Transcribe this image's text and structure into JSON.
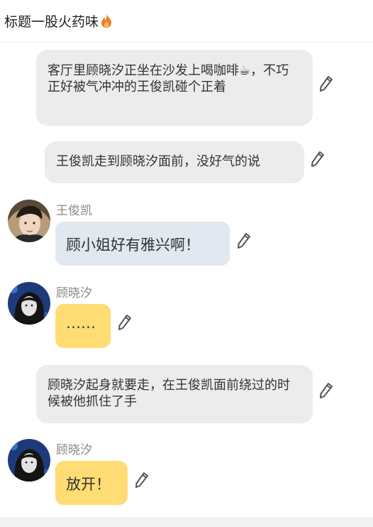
{
  "header": {
    "title": "标题一股火药味"
  },
  "messages": [
    {
      "type": "narration",
      "text": "客厅里顾晓汐正坐在沙发上喝咖啡☕，不巧正好被气冲冲的王俊凯碰个正着"
    },
    {
      "type": "narration",
      "text": "王俊凯走到顾晓汐面前，没好气的说"
    },
    {
      "type": "dialogue",
      "speaker": "王俊凯",
      "text": "顾小姐好有雅兴啊！",
      "bubble_color": "#e1e8f0"
    },
    {
      "type": "dialogue",
      "speaker": "顾晓汐",
      "text": "……",
      "bubble_color": "#ffdd74"
    },
    {
      "type": "narration",
      "text": "顾晓汐起身就要走，在王俊凯面前绕过的时候被他抓住了手"
    },
    {
      "type": "dialogue",
      "speaker": "顾晓汐",
      "text": "放开！",
      "bubble_color": "#ffdd74"
    }
  ]
}
